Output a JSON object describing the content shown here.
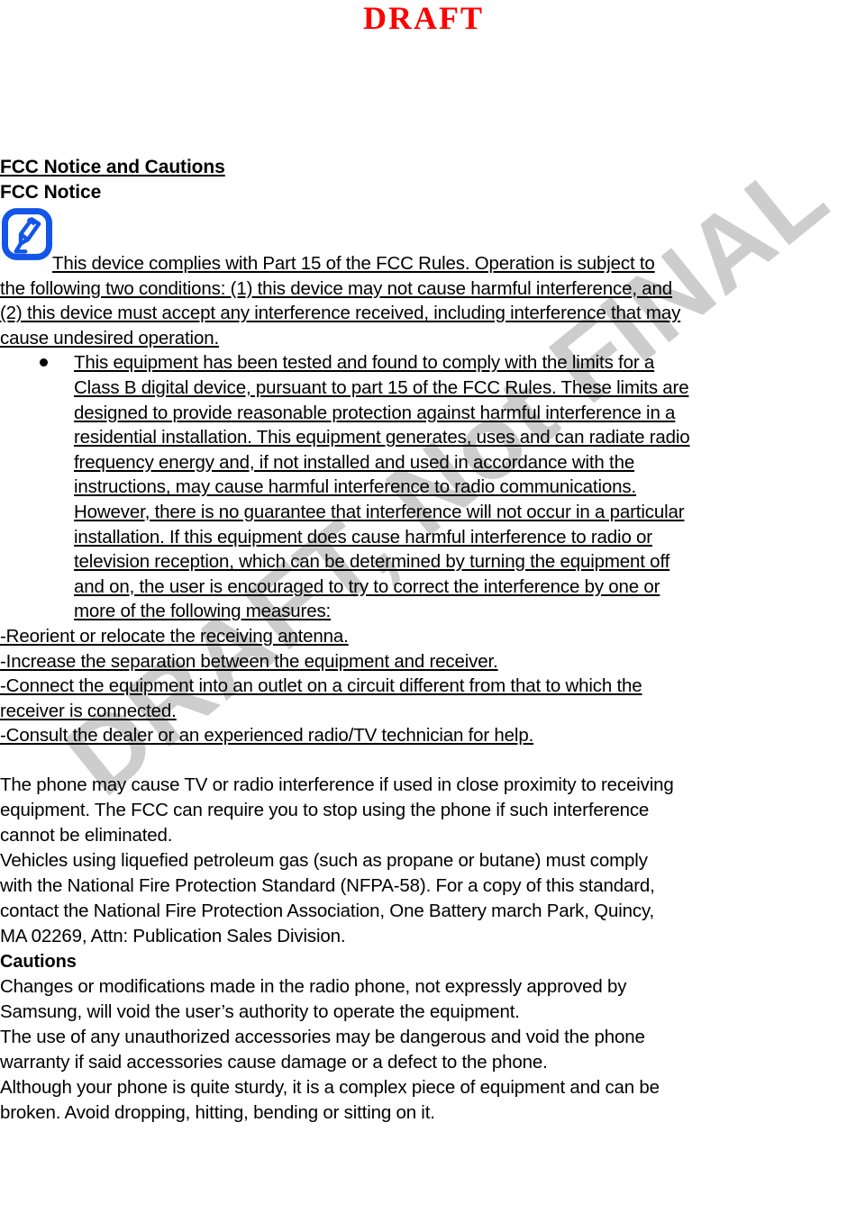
{
  "page": {
    "watermark": "DRAFT, Not FINAL",
    "watermark_color": "#cdcdcd",
    "draft_header": "DRAFT",
    "draft_header_color": "#fe0000",
    "background_color": "#ffffff",
    "text_color": "#000000"
  },
  "headings": {
    "main": "FCC Notice and Cautions",
    "fcc_notice": "FCC Notice",
    "cautions": "Cautions"
  },
  "icon": {
    "name": "note-pencil-icon",
    "color": "#1255e8"
  },
  "intro": {
    "line1": " This device complies with Part 15 of the FCC Rules. Operation is   subject to",
    "line2": "the following two conditions: (1) this device may not cause harmful interference, and",
    "line3": "(2) this device must accept any interference received, including interference that may",
    "line4": "cause undesired operation."
  },
  "bullets": [
    {
      "lines": [
        "This equipment has been tested and found to comply with the limits for a",
        "Class B digital device, pursuant to part 15 of the FCC Rules. These limits are",
        "designed to provide reasonable protection against harmful interference in a",
        "residential installation. This equipment generates, uses and can radiate radio",
        "frequency energy and, if not installed and used in accordance with the",
        "instructions, may cause harmful interference to radio communications.",
        "However, there is no guarantee that interference will not occur in a particular",
        "installation. If this equipment does cause harmful interference to radio or",
        "television reception, which can be determined by turning the equipment off",
        "and on, the user is encouraged to try to correct the interference by one or",
        "more of the following measures:"
      ]
    }
  ],
  "measures": [
    {
      "lines": [
        "-Reorient or relocate the receiving antenna. "
      ]
    },
    {
      "lines": [
        "-Increase the separation between the equipment and receiver. "
      ]
    },
    {
      "lines": [
        "-Connect the equipment into an outlet on a circuit different from that to which the",
        "receiver is connected. "
      ]
    },
    {
      "lines": [
        "-Consult the dealer or an experienced radio/TV technician for help."
      ]
    }
  ],
  "paragraphs": [
    {
      "id": "phone-interference",
      "lines": [
        "The phone may cause TV or radio interference if used in close proximity to receiving",
        "equipment. The FCC can require you to stop using the phone if such interference",
        "cannot be eliminated."
      ]
    },
    {
      "id": "vehicles-lpg",
      "lines": [
        "Vehicles using liquefied petroleum gas (such as propane or butane) must comply",
        "with the National Fire Protection Standard (NFPA-58). For a copy of this standard,",
        "contact the National Fire Protection Association, One Battery march Park, Quincy,",
        "MA 02269, Attn: Publication Sales Division."
      ]
    }
  ],
  "cautions_paragraphs": [
    {
      "id": "changes-modifications",
      "lines": [
        "Changes or modifications made in the radio phone, not expressly approved by",
        "Samsung, will void the user’s authority to operate the equipment."
      ]
    },
    {
      "id": "unauthorized-accessories",
      "lines": [
        "The use of any unauthorized accessories may be dangerous and void the phone",
        "warranty if said accessories cause damage or a defect to the phone."
      ]
    },
    {
      "id": "sturdy-but-breakable",
      "lines": [
        "Although your phone is quite sturdy, it is a complex piece of equipment and can be",
        "broken. Avoid dropping, hitting, bending or sitting on it."
      ]
    }
  ]
}
